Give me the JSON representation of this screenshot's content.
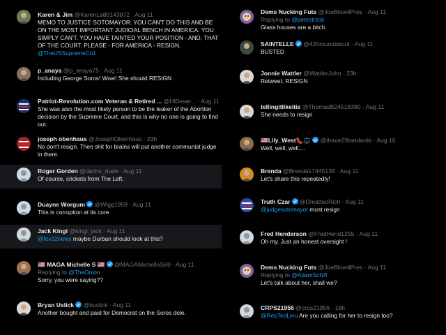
{
  "left_column": [
    {
      "name": "Karen & Jim",
      "handle": "@KarenLa80143872",
      "dot": "·",
      "time": "Aug 11",
      "text": "MEMO TO JUSTICE SOTOMAYOR:  YOU CAN'T DO THIS AND BE ON THE MOST IMPORTANT JUDICIAL BENCH IN AMERICA.  YOU SIMPLY CAN'T.  YOU HAVE TAINTED YOUR POSITION - AND, THAT OF THE COURT.  PLEASE - FOR AMERICA - RESIGN.",
      "mention": "@TheUSSupremeCo1",
      "avatar": "photo-avatar-icon",
      "avatar_color": "#6a7d5a"
    },
    {
      "name": "p_anaya",
      "handle": "@p_anaya75",
      "dot": "·",
      "time": "Aug 11",
      "text": "Including George Soros! Wow! She should RESIGN",
      "avatar": "photo-avatar-icon",
      "avatar_color": "#8a7060"
    },
    {
      "name": "Patriot-Revolution.com Veteran & Retired ...",
      "handle": "@HiDeser...",
      "dot": "·",
      "time": "Aug 11",
      "text": "She was also the most likely person to be the leaker of the Abortion decision by the Supreme Court, and this is why no one is going to find out.",
      "avatar": "flag-badge-icon",
      "avatar_color": "#1c2d6b"
    },
    {
      "name": "joseph obenhaus",
      "handle": "@JosephObenhaus",
      "dot": "·",
      "time": "23h",
      "text": "No don't resign. Then shit for brains will put another communist judge in there.",
      "avatar": "flag-badge-icon",
      "avatar_color": "#b02020"
    },
    {
      "name": "Roger Gorden",
      "handle": "@dachs_dude",
      "dot": "·",
      "time": "Aug 11",
      "text": "Of course, crickets from The Left.",
      "avatar": "default-avatar-icon",
      "avatar_color": "#8b98a5"
    },
    {
      "name": "Duayne Worgum",
      "handle": "@Wigg1959",
      "dot": "·",
      "time": "Aug 11",
      "text": "This is corruption at its core",
      "avatar": "default-avatar-icon",
      "avatar_color": "#8b98a5"
    },
    {
      "name": "Jack Kingi",
      "handle": "@kingi_jack",
      "dot": "·",
      "time": "Aug 11",
      "mention": "@fox32news",
      "text": "maybe Durban should look at this?",
      "avatar": "default-avatar-icon",
      "avatar_color": "#8b98a5"
    },
    {
      "name": "🇺🇸 MAGA Michelle S 🇺🇸",
      "handle": "@MAGAMichelleS69",
      "dot": "·",
      "time": "Aug 11",
      "replying_label": "Replying to",
      "replying_to": "@TheOnion",
      "text": "Sorry, you were saying??",
      "avatar": "photo-avatar-icon",
      "avatar_color": "#a0704a"
    },
    {
      "name": "Bryan Uslick",
      "handle": "@buslick",
      "dot": "·",
      "time": "Aug 11",
      "text": "Another bought and paid for Democrat on the Soros dole.",
      "avatar": "photo-avatar-icon",
      "avatar_color": "#d8d8d8"
    }
  ],
  "right_column": [
    {
      "name": "Dems Nucking Futs",
      "handle": "@JoeBlow4Pres",
      "dot": "·",
      "time": "Aug 11",
      "replying_label": "Replying to",
      "replying_to": "@petestrzok",
      "text": "Glass houses are a bitch.",
      "avatar": "cartoon-avatar-icon",
      "avatar_color": "#7a5fa0"
    },
    {
      "name": "SAINTELLE",
      "handle": "@420roundabout",
      "dot": "·",
      "time": "Aug 11",
      "text": "BUSTED",
      "avatar": "photo-avatar-icon",
      "avatar_color": "#3b4a3a"
    },
    {
      "name": "Jonnie Wattler",
      "handle": "@WattlerJohn",
      "dot": "·",
      "time": "23h",
      "text": "Retweet. RESIGN",
      "avatar": "photo-avatar-icon",
      "avatar_color": "#d8d8d8"
    },
    {
      "name": "tellingitlikeitis",
      "handle": "@ThomasB24516390",
      "dot": "·",
      "time": "Aug 11",
      "text": "She needs to resign",
      "avatar": "photo-avatar-icon",
      "avatar_color": "#d8d8d8"
    },
    {
      "name": "🇺🇸Lily_West👠⚖️",
      "handle": "@Ihave2Standards",
      "dot": "·",
      "time": "Aug 10",
      "text": "Well, well, well....",
      "avatar": "photo-avatar-icon",
      "avatar_color": "#8a6a4a"
    },
    {
      "name": "Brenda",
      "handle": "@Brenda17445136",
      "dot": "·",
      "time": "Aug 11",
      "text": "Let's share this repeatedly!",
      "avatar": "photo-avatar-icon",
      "avatar_color": "#d08a2a"
    },
    {
      "name": "Truth Czar",
      "handle": "@DmatteoRich",
      "dot": "·",
      "time": "Aug 11",
      "mention": "@judgesotomayor",
      "text": "must resign",
      "avatar": "flag-badge-icon",
      "avatar_color": "#2b4aa0"
    },
    {
      "name": "Fred Henderson",
      "handle": "@FredHend1255",
      "dot": "·",
      "time": "Aug 11",
      "text": "Oh my. Just an honest oversight !",
      "avatar": "default-avatar-icon",
      "avatar_color": "#8b98a5"
    },
    {
      "name": "Dems Nucking Futs",
      "handle": "@JoeBlow4Pres",
      "dot": "·",
      "time": "Aug 11",
      "replying_label": "Replying to",
      "replying_to": "@AdamSchiff",
      "text": "Let's talk about her, shall we?",
      "avatar": "cartoon-avatar-icon",
      "avatar_color": "#7a5fa0"
    },
    {
      "name": "CRPS21956",
      "handle": "@crps21956",
      "dot": "·",
      "time": "18h",
      "mention": "@RepTedLieu",
      "text": "Are you calling for her to resign too?",
      "avatar": "default-avatar-icon",
      "avatar_color": "#8b98a5"
    }
  ],
  "colors": {
    "link": "#1d9bf0",
    "muted": "#71767b",
    "verified": "#1d9bf0",
    "highlight_bg": "#16181c"
  }
}
